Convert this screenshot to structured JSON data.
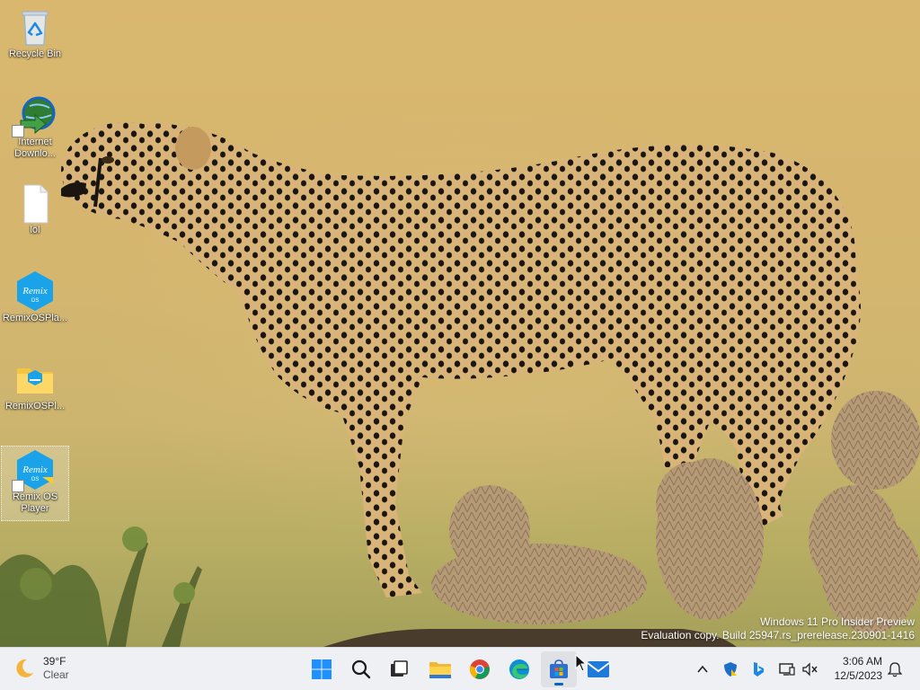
{
  "desktop": {
    "icons": [
      {
        "label": "Recycle Bin",
        "icon": "recycle-bin-icon"
      },
      {
        "label": "Internet Downlo...",
        "icon": "internet-download-manager-icon"
      },
      {
        "label": "lol",
        "icon": "text-file-icon"
      },
      {
        "label": "RemixOSPla...",
        "icon": "remix-os-icon"
      },
      {
        "label": "RemixOSPl...",
        "icon": "folder-icon"
      },
      {
        "label": "Remix OS Player",
        "icon": "remix-os-icon"
      }
    ],
    "watermark": {
      "line1": "Windows 11 Pro Insider Preview",
      "line2": "Evaluation copy. Build 25947.rs_prerelease.230901-1416"
    }
  },
  "taskbar": {
    "weather": {
      "temp": "39°F",
      "condition": "Clear",
      "icon": "moon-icon"
    },
    "apps": [
      {
        "name": "Start",
        "icon": "windows-start-icon"
      },
      {
        "name": "Search",
        "icon": "search-icon"
      },
      {
        "name": "Task View",
        "icon": "task-view-icon"
      },
      {
        "name": "File Explorer",
        "icon": "file-explorer-icon"
      },
      {
        "name": "Google Chrome",
        "icon": "chrome-icon"
      },
      {
        "name": "Microsoft Edge",
        "icon": "edge-icon"
      },
      {
        "name": "Microsoft Store",
        "icon": "store-icon",
        "active": true
      },
      {
        "name": "Mail",
        "icon": "mail-icon"
      }
    ],
    "tray": {
      "icons": [
        "chevron-up-icon",
        "defender-icon",
        "bing-icon",
        "network-icon",
        "volume-muted-icon"
      ],
      "time": "3:06 AM",
      "date": "12/5/2023",
      "notification_icon": "bell-icon"
    }
  },
  "colors": {
    "accent": "#0067c0",
    "taskbar": "#eef0f4"
  }
}
